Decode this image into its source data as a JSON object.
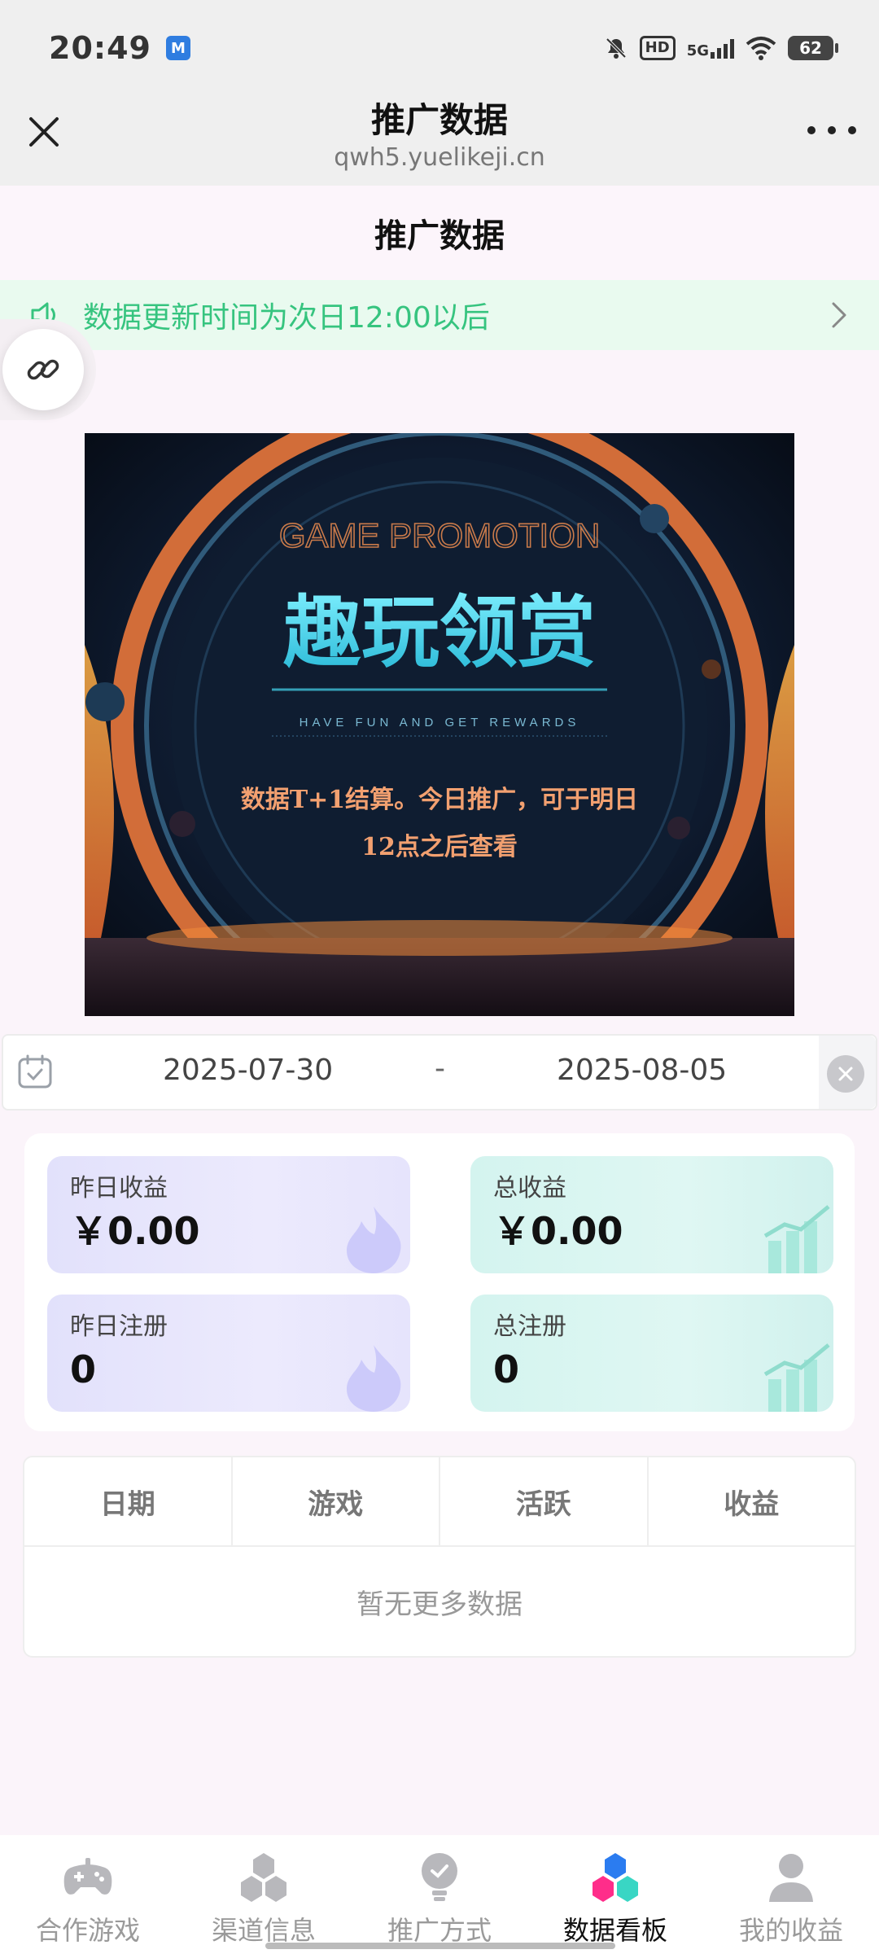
{
  "status_bar": {
    "time": "20:49",
    "app_badge": "M",
    "hd": "HD",
    "network": "5G",
    "battery": "62",
    "icons": [
      "mute-icon",
      "hd-icon",
      "signal-icon",
      "wifi-icon",
      "battery-icon"
    ]
  },
  "browser": {
    "title": "推广数据",
    "url": "qwh5.yuelikeji.cn",
    "close_icon": "close-icon",
    "more_icon": "more-icon"
  },
  "page": {
    "title": "推广数据"
  },
  "notice": {
    "text": "数据更新时间为次日12:00以后",
    "icon": "speaker-icon",
    "accent": "#36c47f"
  },
  "banner": {
    "heading_en": "GAME PROMOTION",
    "heading_cn": "趣玩领赏",
    "tagline": "HAVE FUN AND GET REWARDS",
    "line1": "数据T+1结算。今日推广，可于明日",
    "line2": "12点之后查看"
  },
  "date_range": {
    "start": "2025-07-30",
    "separator": "-",
    "end": "2025-08-05"
  },
  "stats": [
    {
      "label": "昨日收益",
      "value": "￥0.00",
      "theme": "purple"
    },
    {
      "label": "总收益",
      "value": "￥0.00",
      "theme": "teal"
    },
    {
      "label": "昨日注册",
      "value": "0",
      "theme": "purple"
    },
    {
      "label": "总注册",
      "value": "0",
      "theme": "teal"
    }
  ],
  "table": {
    "columns": [
      "日期",
      "游戏",
      "活跃",
      "收益"
    ],
    "empty_text": "暂无更多数据"
  },
  "bottom_nav": {
    "items": [
      {
        "label": "合作游戏",
        "icon": "gamepad-icon"
      },
      {
        "label": "渠道信息",
        "icon": "cubes-icon"
      },
      {
        "label": "推广方式",
        "icon": "lightbulb-icon"
      },
      {
        "label": "数据看板",
        "icon": "dashboard-cubes-icon",
        "active": true
      },
      {
        "label": "我的收益",
        "icon": "user-icon"
      }
    ]
  },
  "colors": {
    "background": "#fbf4fa",
    "purple_card": "#e4e2fc",
    "teal_card": "#d6f4f0",
    "notice_bg": "#e9faef"
  }
}
